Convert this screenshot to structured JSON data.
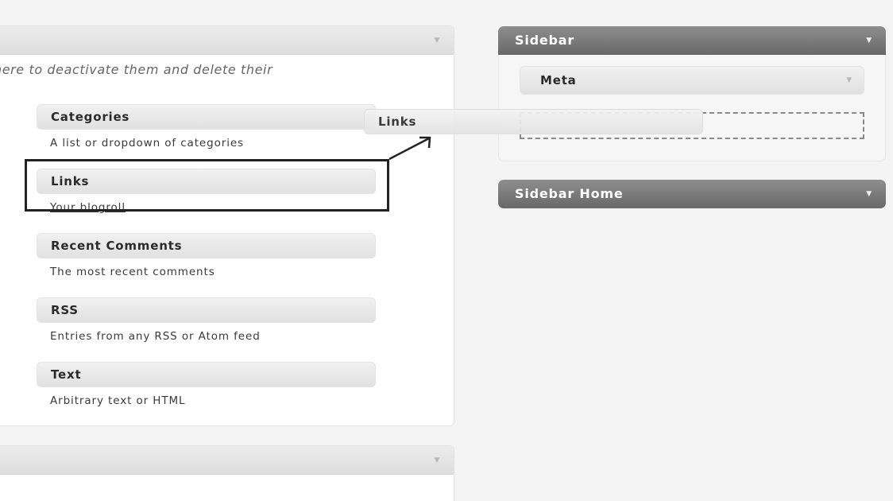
{
  "available_panel": {
    "description": "ck here to deactivate them and delete their",
    "toggle_icon": "▼"
  },
  "widgets": [
    {
      "title": "Categories",
      "description": "A list or dropdown of categories"
    },
    {
      "title": "Links",
      "description": "Your blogroll"
    },
    {
      "title": "Recent Comments",
      "description": "The most recent comments"
    },
    {
      "title": "RSS",
      "description": "Entries from any RSS or Atom feed"
    },
    {
      "title": "Text",
      "description": "Arbitrary text or HTML"
    }
  ],
  "drag_helper": {
    "title": "Links"
  },
  "sidebars": [
    {
      "title": "Sidebar",
      "toggle_icon": "▼",
      "widgets": [
        {
          "title": "Meta",
          "toggle_icon": "▼"
        }
      ]
    },
    {
      "title": "Sidebar Home",
      "toggle_icon": "▼"
    }
  ]
}
